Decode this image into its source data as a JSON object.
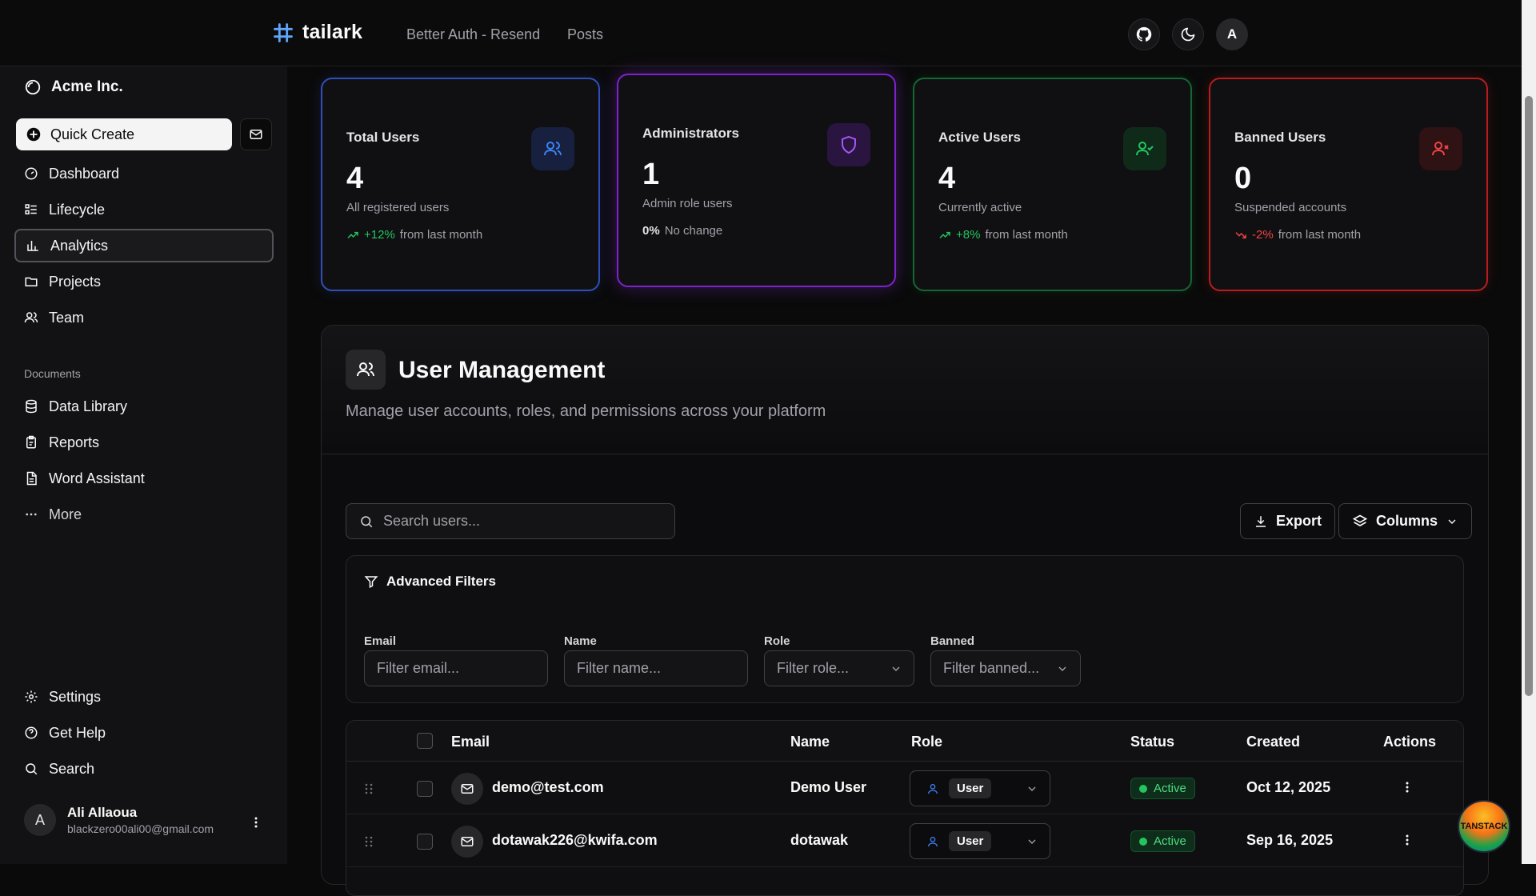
{
  "topnav": {
    "brand": "tailark",
    "links": [
      "Better Auth - Resend",
      "Posts"
    ],
    "avatar_letter": "A"
  },
  "sidebar": {
    "org": "Acme Inc.",
    "quick_create": "Quick Create",
    "main_items": [
      {
        "label": "Dashboard",
        "icon": "dashboard-icon"
      },
      {
        "label": "Lifecycle",
        "icon": "list-icon"
      },
      {
        "label": "Analytics",
        "icon": "bar-chart-icon",
        "active": true
      },
      {
        "label": "Projects",
        "icon": "folder-icon"
      },
      {
        "label": "Team",
        "icon": "users-icon"
      }
    ],
    "documents_label": "Documents",
    "doc_items": [
      {
        "label": "Data Library",
        "icon": "database-icon"
      },
      {
        "label": "Reports",
        "icon": "clipboard-icon"
      },
      {
        "label": "Word Assistant",
        "icon": "file-icon"
      },
      {
        "label": "More",
        "icon": "dots-icon"
      }
    ],
    "footer_items": [
      {
        "label": "Settings",
        "icon": "gear-icon"
      },
      {
        "label": "Get Help",
        "icon": "help-icon"
      },
      {
        "label": "Search",
        "icon": "search-icon"
      }
    ],
    "user": {
      "initial": "A",
      "name": "Ali Allaoua",
      "email": "blackzero00ali00@gmail.com"
    }
  },
  "stats": [
    {
      "title": "Total Users",
      "value": "4",
      "desc": "All registered users",
      "change": "+12%",
      "change_suffix": "from last month",
      "trend": "up",
      "color": "#3b82f6"
    },
    {
      "title": "Administrators",
      "value": "1",
      "desc": "Admin role users",
      "change": "0%",
      "change_suffix": "No change",
      "trend": "none",
      "color": "#a855f7"
    },
    {
      "title": "Active Users",
      "value": "4",
      "desc": "Currently active",
      "change": "+8%",
      "change_suffix": "from last month",
      "trend": "up",
      "color": "#22c55e"
    },
    {
      "title": "Banned Users",
      "value": "0",
      "desc": "Suspended accounts",
      "change": "-2%",
      "change_suffix": "from last month",
      "trend": "down",
      "color": "#ef4444"
    }
  ],
  "panel": {
    "title": "User Management",
    "subtitle": "Manage user accounts, roles, and permissions across your platform",
    "search_placeholder": "Search users...",
    "export_label": "Export",
    "columns_label": "Columns",
    "filters": {
      "title": "Advanced Filters",
      "email_label": "Email",
      "email_placeholder": "Filter email...",
      "name_label": "Name",
      "name_placeholder": "Filter name...",
      "role_label": "Role",
      "role_placeholder": "Filter role...",
      "banned_label": "Banned",
      "banned_placeholder": "Filter banned..."
    },
    "table": {
      "headers": [
        "Email",
        "Name",
        "Role",
        "Status",
        "Created",
        "Actions"
      ],
      "rows": [
        {
          "email": "demo@test.com",
          "name": "Demo User",
          "role": "User",
          "status": "Active",
          "created": "Oct 12, 2025"
        },
        {
          "email": "dotawak226@kwifa.com",
          "name": "dotawak",
          "role": "User",
          "status": "Active",
          "created": "Sep 16, 2025"
        }
      ]
    }
  },
  "badge": "TANSTACK"
}
